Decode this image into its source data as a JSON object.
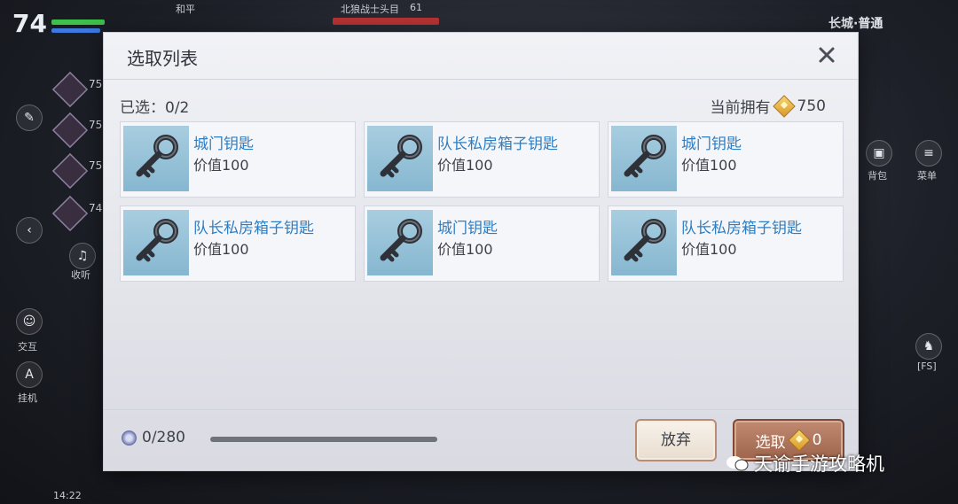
{
  "hud": {
    "level": "74",
    "ally_name": "和平",
    "enemy_name": "北狼战士头目",
    "enemy_level": "61",
    "zone": "长城·普通",
    "party": [
      "75",
      "75",
      "75",
      "74"
    ],
    "side_labels": {
      "listen": "收听",
      "interact": "交互",
      "hangup": "挂机",
      "bag": "背包",
      "menu": "菜单",
      "fs": "[FS]"
    },
    "time": "14:22"
  },
  "modal": {
    "title": "选取列表",
    "selected_count": "已选：0/2",
    "owned_label": "当前拥有",
    "owned_value": "750",
    "items": [
      {
        "name": "城门钥匙",
        "value": "价值100"
      },
      {
        "name": "队长私房箱子钥匙",
        "value": "价值100"
      },
      {
        "name": "城门钥匙",
        "value": "价值100"
      },
      {
        "name": "队长私房箱子钥匙",
        "value": "价值100"
      },
      {
        "name": "城门钥匙",
        "value": "价值100"
      },
      {
        "name": "队长私房箱子钥匙",
        "value": "价值100"
      }
    ],
    "capacity": "0/280",
    "progress_fraction": 1.0,
    "abandon_label": "放弃",
    "select_label": "选取",
    "select_cost": "0"
  },
  "watermark": "天谕手游攻略机",
  "colors": {
    "item_name": "#2f7ec2",
    "select_button": "#a86c53",
    "coin": "#e0a83a"
  },
  "icons": {
    "close": "close-icon",
    "coin": "coin-icon",
    "key": "key-icon",
    "capacity": "capacity-icon"
  }
}
